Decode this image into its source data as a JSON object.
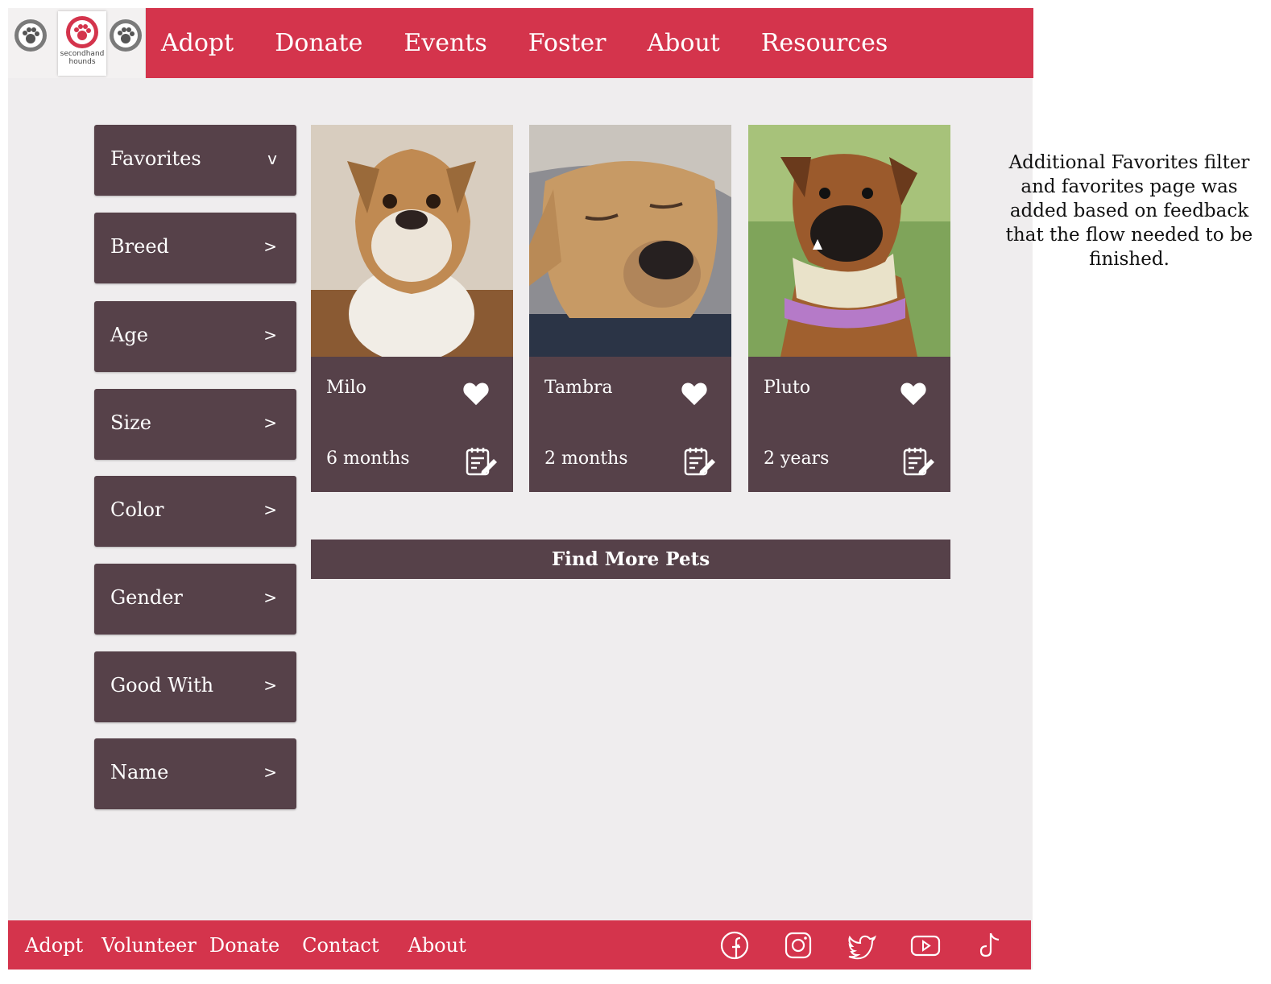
{
  "header": {
    "logo_text": "secondhand hounds",
    "nav": [
      "Adopt",
      "Donate",
      "Events",
      "Foster",
      "About",
      "Resources"
    ]
  },
  "filters": [
    {
      "label": "Favorites",
      "chevron": "v"
    },
    {
      "label": "Breed",
      "chevron": ">"
    },
    {
      "label": "Age",
      "chevron": ">"
    },
    {
      "label": "Size",
      "chevron": ">"
    },
    {
      "label": "Color",
      "chevron": ">"
    },
    {
      "label": "Gender",
      "chevron": ">"
    },
    {
      "label": "Good With",
      "chevron": ">"
    },
    {
      "label": "Name",
      "chevron": ">"
    }
  ],
  "pets": [
    {
      "name": "Milo",
      "age": "6 months"
    },
    {
      "name": "Tambra",
      "age": "2 months"
    },
    {
      "name": "Pluto",
      "age": "2 years"
    }
  ],
  "find_more_label": "Find More Pets",
  "note": "Additional Favorites filter and favorites page was added based on feedback that the flow needed to be finished.",
  "footer": {
    "nav": [
      "Adopt",
      "Volunteer",
      "Donate",
      "Contact",
      "About"
    ],
    "social": [
      "facebook-icon",
      "instagram-icon",
      "twitter-icon",
      "youtube-icon",
      "tiktok-icon"
    ]
  },
  "colors": {
    "brand_red": "#d4344c",
    "card_plum": "#564149",
    "page_bg": "#efedee"
  }
}
